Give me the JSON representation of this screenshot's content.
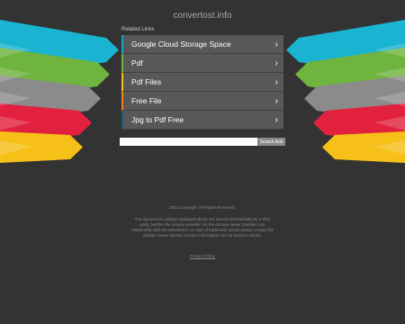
{
  "site": {
    "domain": "convertost.info"
  },
  "related_label": "Related Links",
  "links": [
    {
      "label": "Google Cloud Storage Space",
      "accent": "#1aa2c6"
    },
    {
      "label": "Pdf",
      "accent": "#6fb43f"
    },
    {
      "label": "Pdf Files",
      "accent": "#f6c018"
    },
    {
      "label": "Free File",
      "accent": "#f0821e"
    },
    {
      "label": "Jpg to Pdf Free",
      "accent": "#16627a"
    }
  ],
  "search": {
    "placeholder": "",
    "button_label": "Search Ads"
  },
  "footer": {
    "copyright": "2021 Copyright. All Rights Reserved.",
    "disclaimer": "The Sponsored Listings displayed above are served automatically by a third party. Neither the service provider nor the domain owner maintain any relationship with the advertisers. In case of trademark issues please contact the domain owner directly (contact information can be found in whois).",
    "privacy_label": "Privacy Policy"
  },
  "colors": {
    "background": "#333333",
    "ribbons": [
      "#1ab3d1",
      "#6fb43f",
      "#8b8b8b",
      "#e2213f",
      "#f6c018"
    ]
  },
  "icons": {
    "link_chevron": "chevron-right-icon"
  }
}
